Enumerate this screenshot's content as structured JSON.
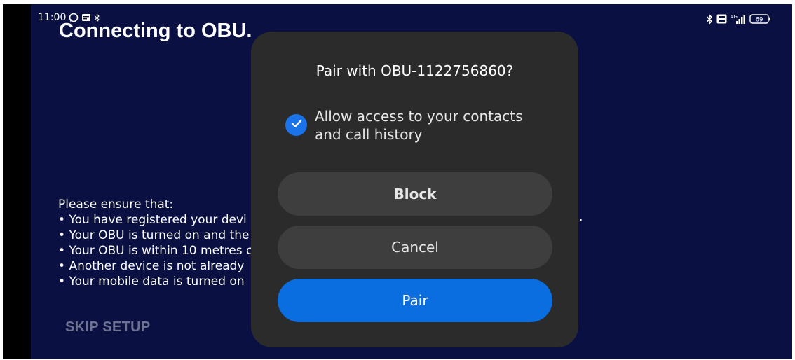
{
  "status_bar": {
    "time": "11:00",
    "battery": "69",
    "network": "4G"
  },
  "background": {
    "title": "Connecting to OBU.",
    "instructions_heading": "Please ensure that:",
    "instructions": [
      "You have registered your devi",
      "Your OBU is turned on and the",
      "Your OBU is within 10 metres c",
      "Another device is not already",
      "Your mobile data is turned on"
    ],
    "stray_text": ".",
    "skip_label": "SKIP SETUP"
  },
  "dialog": {
    "title": "Pair with OBU-1122756860?",
    "checkbox_checked": true,
    "checkbox_label": "Allow access to your contacts and call history",
    "buttons": {
      "block": "Block",
      "cancel": "Cancel",
      "pair": "Pair"
    }
  },
  "colors": {
    "app_background": "#0a1042",
    "dialog_background": "#2b2b2b",
    "secondary_button": "#3e3e3e",
    "accent": "#0a6ee0",
    "skip_text": "#6d7290"
  },
  "icons": {
    "status_left": [
      "whatsapp-icon",
      "message-icon",
      "bluetooth-icon"
    ],
    "status_right": [
      "bluetooth-icon",
      "volte-icon",
      "signal-icon",
      "battery-icon"
    ],
    "checkbox": "checkmark-icon"
  }
}
